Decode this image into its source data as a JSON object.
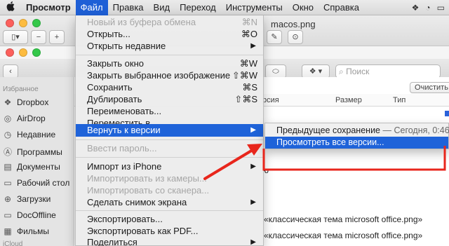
{
  "menubar": {
    "app": "Просмотр",
    "items": [
      "Файл",
      "Правка",
      "Вид",
      "Переход",
      "Инструменты",
      "Окно",
      "Справка"
    ]
  },
  "window": {
    "title": "macos.png",
    "search_placeholder": "Поиск",
    "clear_button": "Очистить",
    "columns": {
      "version": "рсия",
      "size": "Размер",
      "type": "Тип"
    }
  },
  "sidebar": {
    "header": "Избранное",
    "items": [
      {
        "label": "Dropbox",
        "icon": "dropbox-icon"
      },
      {
        "label": "AirDrop",
        "icon": "airdrop-icon"
      },
      {
        "label": "Недавние",
        "icon": "clock-icon"
      },
      {
        "label": "Программы",
        "icon": "apps-icon"
      },
      {
        "label": "Документы",
        "icon": "document-icon"
      },
      {
        "label": "Рабочий стол",
        "icon": "desktop-icon"
      },
      {
        "label": "Загрузки",
        "icon": "download-icon"
      },
      {
        "label": "DocOffline",
        "icon": "folder-icon"
      },
      {
        "label": "Фильмы",
        "icon": "film-icon"
      }
    ],
    "footer": "iCloud"
  },
  "list": {
    "rows": [
      "«классическая тема microsoft office.png»",
      "«классическая тема microsoft office.png»"
    ],
    "partial": "ю"
  },
  "file_menu": {
    "items": [
      {
        "label": "Новый из буфера обмена",
        "shortcut": "⌘N",
        "disabled": true
      },
      {
        "label": "Открыть...",
        "shortcut": "⌘O"
      },
      {
        "label": "Открыть недавние",
        "submenu": true
      },
      {
        "label": "Закрыть окно",
        "shortcut": "⌘W"
      },
      {
        "label": "Закрыть выбранное изображение",
        "shortcut": "⇧⌘W"
      },
      {
        "label": "Сохранить",
        "shortcut": "⌘S"
      },
      {
        "label": "Дублировать",
        "shortcut": "⇧⌘S"
      },
      {
        "label": "Переименовать..."
      },
      {
        "label": "Переместить в..."
      },
      {
        "label": "Вернуть к версии",
        "submenu": true,
        "highlighted": true
      },
      {
        "label": "Ввести пароль...",
        "disabled": true
      },
      {
        "label": "Импорт из iPhone",
        "submenu": true
      },
      {
        "label": "Импортировать из камеры...",
        "disabled": true
      },
      {
        "label": "Импортировать со сканера...",
        "disabled": true
      },
      {
        "label": "Сделать снимок экрана",
        "submenu": true
      },
      {
        "label": "Экспортировать..."
      },
      {
        "label": "Экспортировать как PDF..."
      },
      {
        "label": "Поделиться",
        "submenu": true
      }
    ]
  },
  "submenu": {
    "previous_save": "Предыдущее сохранение",
    "previous_time": " — Сегодня, 0:46",
    "browse_all": "Просмотреть все версии..."
  },
  "colors": {
    "highlight": "#1f63d9",
    "annotation": "#e8261c"
  }
}
